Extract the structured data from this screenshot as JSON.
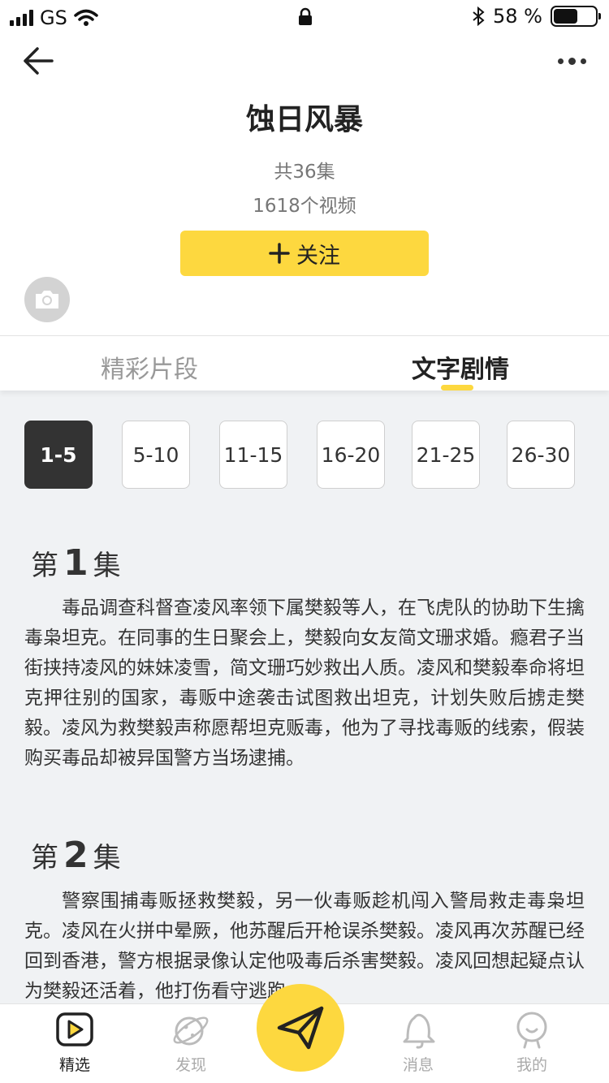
{
  "status_bar": {
    "carrier": "GS",
    "battery_text": "58 %"
  },
  "header": {
    "title": "蚀日风暴",
    "episodes": "共36集",
    "videos": "1618个视频",
    "follow_label": "关注"
  },
  "tabs": [
    {
      "label": "精彩片段"
    },
    {
      "label": "文字剧情"
    }
  ],
  "ranges": [
    "1-5",
    "5-10",
    "11-15",
    "16-20",
    "21-25",
    "26-30"
  ],
  "episodes": [
    {
      "prefix": "第",
      "number": "1",
      "suffix": "集",
      "text": "毒品调查科督查凌风率领下属樊毅等人，在飞虎队的协助下生擒毒枭坦克。在同事的生日聚会上，樊毅向女友简文珊求婚。瘾君子当街挟持凌风的妹妹凌雪，简文珊巧妙救出人质。凌风和樊毅奉命将坦克押往别的国家，毒贩中途袭击试图救出坦克，计划失败后掳走樊毅。凌风为救樊毅声称愿帮坦克贩毒，他为了寻找毒贩的线索，假装购买毒品却被异国警方当场逮捕。"
    },
    {
      "prefix": "第",
      "number": "2",
      "suffix": "集",
      "text": "警察围捕毒贩拯救樊毅，另一伙毒贩趁机闯入警局救走毒枭坦克。凌风在火拼中晕厥，他苏醒后开枪误杀樊毅。凌风再次苏醒已经回到香港，警方根据录像认定他吸毒后杀害樊毅。凌风回想起疑点认为樊毅还活着，他打伤看守逃跑。"
    }
  ],
  "nav": [
    {
      "label": "精选"
    },
    {
      "label": "发现"
    },
    {
      "label": "消息"
    },
    {
      "label": "我的"
    }
  ],
  "colors": {
    "accent": "#fdd83f",
    "active_chip": "#333333",
    "background": "#f0f2f4"
  }
}
